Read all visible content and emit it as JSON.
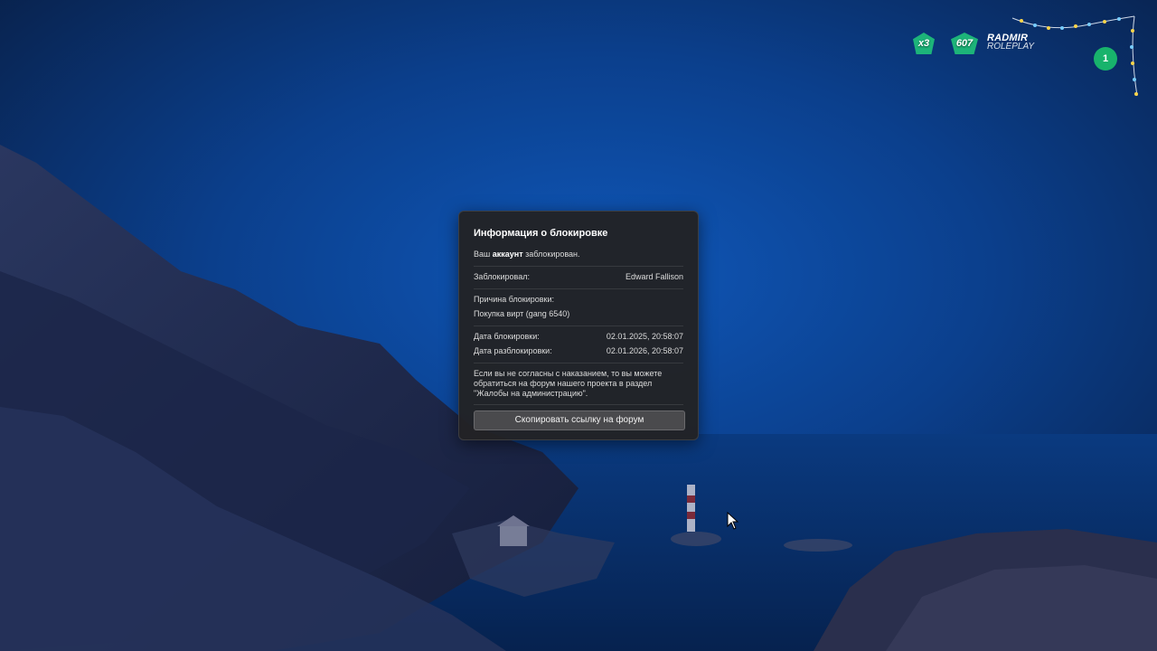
{
  "hud": {
    "multiplier": "x3",
    "online": "607",
    "logo_line1": "RADMIR",
    "logo_line2": "ROLEPLAY",
    "server_number": "1"
  },
  "dialog": {
    "title": "Информация о блокировке",
    "status_prefix": "Ваш",
    "status_bold": "аккаунт",
    "status_suffix": "заблокирован.",
    "blocked_by_label": "Заблокировал:",
    "blocked_by_value": "Edward Fallison",
    "reason_label": "Причина блокировки:",
    "reason_value": "Покупка вирт (gang 6540)",
    "block_date_label": "Дата блокировки:",
    "block_date_value": "02.01.2025, 20:58:07",
    "unblock_date_label": "Дата разблокировки:",
    "unblock_date_value": "02.01.2026, 20:58:07",
    "note_line1": "Если вы не согласны с наказанием, то вы можете",
    "note_line2": "обратиться на форум нашего проекта в раздел",
    "note_line3": "\"Жалобы на администрацию\".",
    "copy_button": "Скопировать ссылку на форум"
  },
  "colors": {
    "sky_top": "#0b1f45",
    "sky_mid": "#0e4aa0",
    "hud_green": "#1fc27a",
    "dialog_bg": "#222224",
    "button_bg": "#4a4a4d"
  }
}
